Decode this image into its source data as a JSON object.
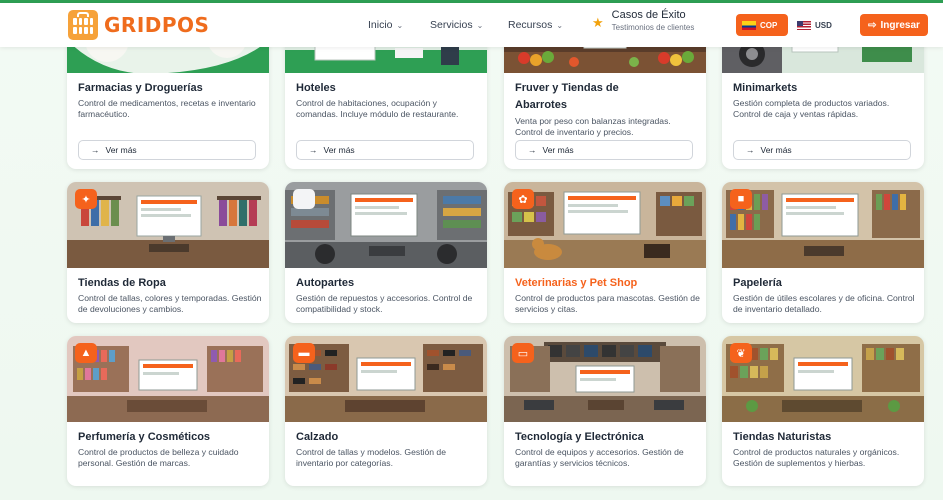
{
  "brand": {
    "name_a": "GRID",
    "name_b": "POS"
  },
  "nav": {
    "inicio": "Inicio",
    "servicios": "Servicios",
    "recursos": "Recursos",
    "casos_title": "Casos de Éxito",
    "casos_sub": "Testimonios de clientes"
  },
  "currency": {
    "cop": "COP",
    "usd": "USD"
  },
  "login_label": "Ingresar",
  "ver_mas_label": "Ver más",
  "colors": {
    "accent": "#f5621c",
    "brand_green": "#2e9f54",
    "star": "#f2a20c"
  },
  "cards": [
    {
      "title": "Farmacias y Droguerías",
      "desc": "Control de medicamentos, recetas e inventario farmacéutico."
    },
    {
      "title": "Hoteles",
      "desc": "Control de habitaciones, ocupación y comandas. Incluye módulo de restaurante."
    },
    {
      "title": "Fruver y Tiendas de Abarrotes",
      "desc": "Venta por peso con balanzas integradas. Control de inventario y precios."
    },
    {
      "title": "Minimarkets",
      "desc": "Gestión completa de productos variados. Control de caja y ventas rápidas."
    },
    {
      "title": "Tiendas de Ropa",
      "desc": "Control de tallas, colores y temporadas. Gestión de devoluciones y cambios."
    },
    {
      "title": "Autopartes",
      "desc": "Gestión de repuestos y accesorios. Control de compatibilidad y stock."
    },
    {
      "title": "Veterinarias y Pet Shop",
      "desc": "Control de productos para mascotas. Gestión de servicios y citas."
    },
    {
      "title": "Papelería",
      "desc": "Gestión de útiles escolares y de oficina. Control de inventario detallado."
    },
    {
      "title": "Perfumería y Cosméticos",
      "desc": "Control de productos de belleza y cuidado personal. Gestión de marcas."
    },
    {
      "title": "Calzado",
      "desc": "Control de tallas y modelos. Gestión de inventario por categorías."
    },
    {
      "title": "Tecnología y Electrónica",
      "desc": "Control de equipos y accesorios. Gestión de garantías y servicios técnicos."
    },
    {
      "title": "Tiendas Naturistas",
      "desc": "Control de productos naturales y orgánicos. Gestión de suplementos y hierbas."
    }
  ],
  "icons": {
    "ropa": "shirt-icon",
    "autopartes": "wrench-icon",
    "veterinaria": "paw-icon",
    "papeleria": "folder-icon",
    "perfumeria": "spray-bottle-icon",
    "calzado": "shoe-icon",
    "tecnologia": "laptop-icon",
    "naturistas": "leaf-icon"
  }
}
